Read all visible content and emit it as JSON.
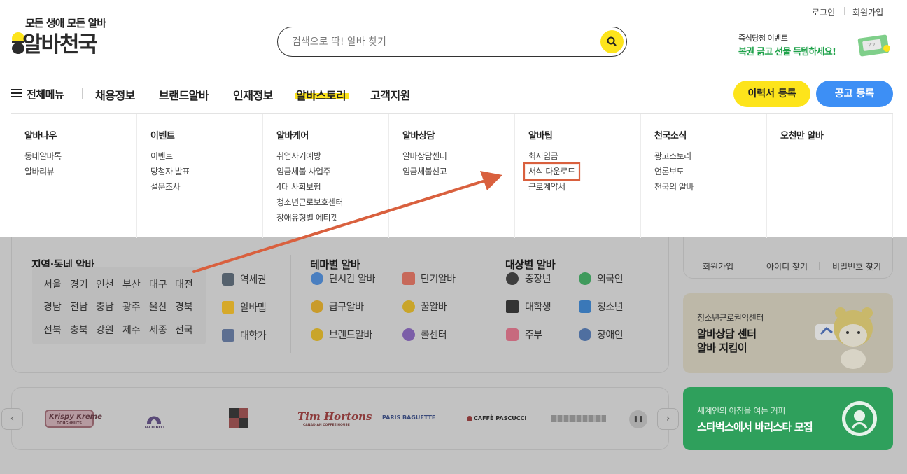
{
  "top_links": {
    "login": "로그인",
    "signup": "회원가입"
  },
  "logo": {
    "tagline": "모든 생애 모든 알바",
    "name": "알바천국"
  },
  "search": {
    "placeholder": "검색으로 딱! 알바 찾기"
  },
  "promo": {
    "line1": "즉석당첨 이벤트",
    "line2": "복권 긁고 선물 득템하세요!"
  },
  "nav": {
    "all_menu": "전체메뉴",
    "items": [
      "채용정보",
      "브랜드알바",
      "인재정보",
      "알바스토리",
      "고객지원"
    ],
    "resume_button": "이력서 등록",
    "post_button": "공고 등록"
  },
  "mega_menu": [
    {
      "title": "알바나우",
      "items": [
        "동네알바톡",
        "알바리뷰"
      ]
    },
    {
      "title": "이벤트",
      "items": [
        "이벤트",
        "당첨자 발표",
        "설문조사"
      ]
    },
    {
      "title": "알바케어",
      "items": [
        "취업사기예방",
        "임금체불 사업주",
        "4대 사회보험",
        "청소년근로보호센터",
        "장애유형별 에티켓"
      ]
    },
    {
      "title": "알바상담",
      "items": [
        "알바상담센터",
        "임금체불신고"
      ]
    },
    {
      "title": "알바팁",
      "items": [
        "최저임금",
        "서식 다운로드",
        "근로계약서"
      ]
    },
    {
      "title": "천국소식",
      "items": [
        "광고스토리",
        "언론보도",
        "천국의 알바"
      ]
    },
    {
      "title": "오천만 알바",
      "items": []
    }
  ],
  "region_section": {
    "title": "지역·동네 알바",
    "regions": [
      "서울",
      "경기",
      "인천",
      "부산",
      "대구",
      "대전",
      "경남",
      "전남",
      "충남",
      "광주",
      "울산",
      "경북",
      "전북",
      "충북",
      "강원",
      "제주",
      "세종",
      "전국"
    ],
    "links": [
      "역세권",
      "알바맵",
      "대학가"
    ]
  },
  "theme_section": {
    "title": "테마별 알바",
    "items": [
      "단시간 알바",
      "단기알바",
      "급구알바",
      "꿀알바",
      "브랜드알바",
      "콜센터"
    ]
  },
  "target_section": {
    "title": "대상별 알바",
    "items": [
      "중장년",
      "외국인",
      "대학생",
      "청소년",
      "주부",
      "장애인"
    ]
  },
  "account_links": [
    "회원가입",
    "아이디 찾기",
    "비밀번호 찾기"
  ],
  "banner_counsel": {
    "line1": "청소년근로권익센터",
    "line2": "알바상담 센터",
    "line3": "알바 지킴이"
  },
  "banner_starbucks": {
    "line1": "세계인의 아침을 여는 커피",
    "line2": "스타벅스에서 바리스타 모집"
  },
  "brands": [
    "Krispy Kreme",
    "TACO BELL",
    "",
    "Tim Hortons",
    "PARIS BAGUETTE",
    "CAFFÈ PASCUCCI",
    ""
  ],
  "brand_sublabels": {
    "timhortons": "CANADIAN COFFEE HOUSE",
    "krispy": "DOUGHNUTS",
    "tacobell": "TACO BELL"
  },
  "colors": {
    "accent_yellow": "#fde41b",
    "accent_blue": "#3d8ff5",
    "annotation": "#d9603e",
    "starbucks_green": "#2fa05c"
  }
}
